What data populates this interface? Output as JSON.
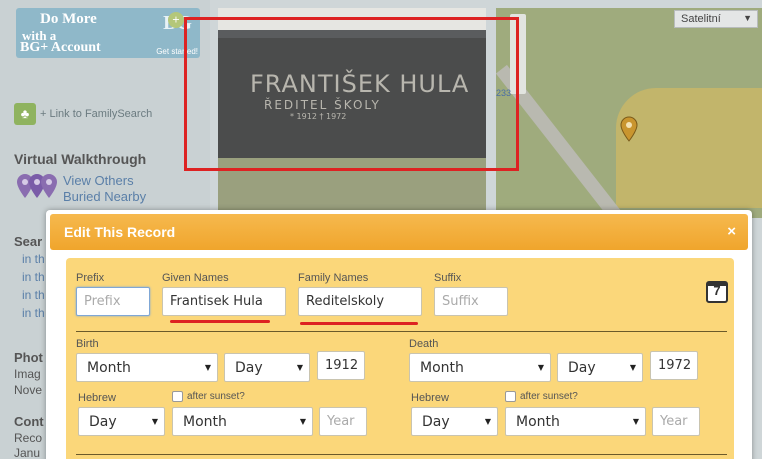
{
  "sidebar": {
    "promo": {
      "line1": "Do More",
      "line2": "with a",
      "line3": "BG+ Account",
      "badge": "BG",
      "plus": "+",
      "cta": "Get started!"
    },
    "familysearch_link": "+ Link to FamilySearch",
    "walkthrough_title": "Virtual Walkthrough",
    "walkthrough_link": "View Others Buried Nearby",
    "fragments": {
      "search": "Sear",
      "in1": "in th",
      "in2": "in th",
      "in3": "in th",
      "in4": "in th",
      "photo": "Phot",
      "image": "Imag",
      "nove": "Nove",
      "cont": "Cont",
      "reco": "Reco",
      "janu": "Janu"
    }
  },
  "photo": {
    "inscription_line1": "FRANTIŠEK HULA",
    "inscription_line2": "ŘEDITEL ŠKOLY",
    "inscription_line3": "* 1912  † 1972"
  },
  "map": {
    "type_label": "Satelitní",
    "scale_label": "233"
  },
  "dialog": {
    "title": "Edit This Record",
    "close_label": "×",
    "calendar_label": "7",
    "name": {
      "prefix_label": "Prefix",
      "prefix_placeholder": "Prefix",
      "given_label": "Given Names",
      "given_value": "Frantisek Hula",
      "family_label": "Family Names",
      "family_value": "Reditelskoly",
      "suffix_label": "Suffix",
      "suffix_placeholder": "Suffix"
    },
    "birth": {
      "label": "Birth",
      "month": "Month",
      "day": "Day",
      "year": "1912",
      "hebrew_label": "Hebrew",
      "after_sunset": "after sunset?",
      "hebrew_day": "Day",
      "hebrew_month": "Month",
      "hebrew_year_placeholder": "Year"
    },
    "death": {
      "label": "Death",
      "month": "Month",
      "day": "Day",
      "year": "1972",
      "hebrew_label": "Hebrew",
      "after_sunset": "after sunset?",
      "hebrew_day": "Day",
      "hebrew_month": "Month",
      "hebrew_year_placeholder": "Year"
    }
  },
  "colors": {
    "header": "#f0a52c",
    "body": "#fbd77a",
    "highlight": "#dd2222"
  }
}
